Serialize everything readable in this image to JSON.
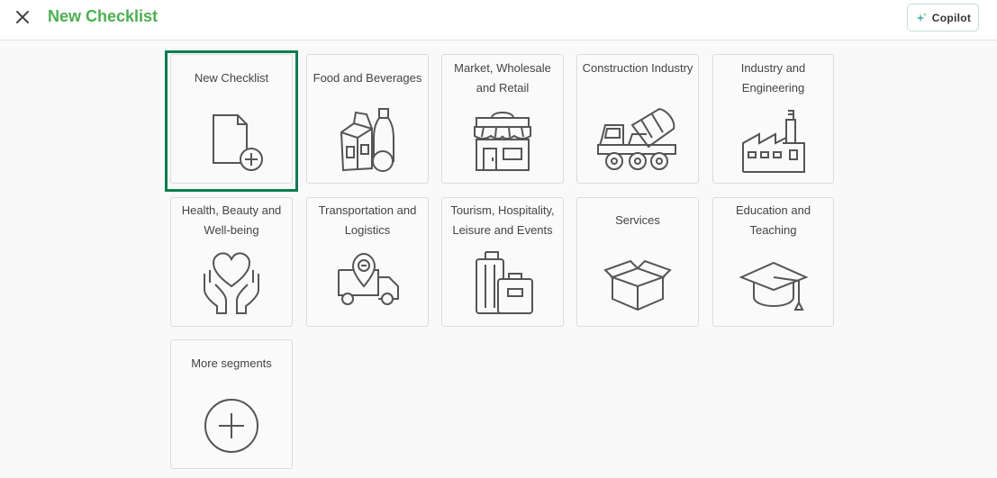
{
  "header": {
    "title": "New Checklist",
    "close_icon": "close-icon",
    "copilot_label": "Copilot",
    "copilot_icon": "sparkle-icon",
    "title_color": "#4caf50"
  },
  "tiles": [
    {
      "label": "New Checklist",
      "icon": "document-add-icon",
      "selected": true
    },
    {
      "label": "Food and Beverages",
      "icon": "groceries-icon"
    },
    {
      "label": "Market, Wholesale and Retail",
      "icon": "storefront-icon"
    },
    {
      "label": "Construction Industry",
      "icon": "cement-truck-icon"
    },
    {
      "label": "Industry and Engineering",
      "icon": "factory-icon"
    },
    {
      "label": "Health, Beauty and Well-being",
      "icon": "heart-hands-icon"
    },
    {
      "label": "Transportation and Logistics",
      "icon": "delivery-truck-icon"
    },
    {
      "label": "Tourism, Hospitality, Leisure and Events",
      "icon": "luggage-icon"
    },
    {
      "label": "Services",
      "icon": "open-box-icon"
    },
    {
      "label": "Education and Teaching",
      "icon": "graduation-cap-icon"
    },
    {
      "label": "More segments",
      "icon": "plus-circle-icon"
    }
  ],
  "colors": {
    "accent": "#4caf50",
    "selected_border": "#0a7d51",
    "icon_stroke": "#555555"
  }
}
